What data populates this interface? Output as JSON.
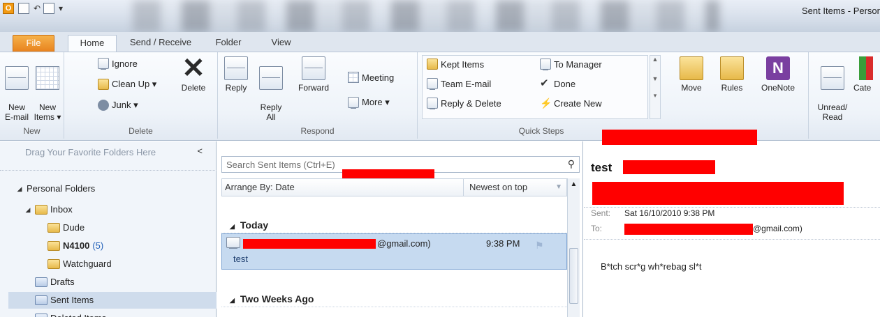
{
  "window": {
    "title": "Sent Items - Persor"
  },
  "tabs": {
    "file": "File",
    "home": "Home",
    "send_receive": "Send / Receive",
    "folder": "Folder",
    "view": "View"
  },
  "ribbon": {
    "new_group": {
      "label": "New",
      "new_email": "New\nE-mail",
      "new_items": "New\nItems ▾"
    },
    "delete_group": {
      "label": "Delete",
      "ignore": "Ignore",
      "clean_up": "Clean Up ▾",
      "junk": "Junk ▾",
      "delete": "Delete"
    },
    "respond_group": {
      "label": "Respond",
      "reply": "Reply",
      "reply_all": "Reply\nAll",
      "forward": "Forward",
      "meeting": "Meeting",
      "more": "More ▾"
    },
    "quick_steps": {
      "label": "Quick Steps",
      "kept_items": "Kept Items",
      "team_email": "Team E-mail",
      "reply_delete": "Reply & Delete",
      "to_manager": "To Manager",
      "done": "Done",
      "create_new": "Create New"
    },
    "move_group": {
      "move": "Move",
      "rules": "Rules",
      "onenote": "OneNote"
    },
    "tags_group": {
      "unread_read": "Unread/\nRead",
      "categorize": "Cate"
    }
  },
  "nav": {
    "drag_favorites": "Drag Your Favorite Folders Here",
    "personal_folders": "Personal Folders",
    "inbox": "Inbox",
    "dude": "Dude",
    "n4100": "N4100",
    "n4100_count": "(5)",
    "watchguard": "Watchguard",
    "drafts": "Drafts",
    "sent_items": "Sent Items",
    "deleted_items": "Deleted Items"
  },
  "list": {
    "search_placeholder": "Search Sent Items (Ctrl+E)",
    "arrange_by": "Arrange By: Date",
    "sort_order": "Newest on top",
    "group_today": "Today",
    "group_two_weeks": "Two Weeks Ago",
    "item": {
      "from_suffix": "@gmail.com)",
      "time": "9:38 PM",
      "subject": "test"
    }
  },
  "reading": {
    "subject": "test",
    "sent_label": "Sent:",
    "sent_value": "Sat 16/10/2010 9:38 PM",
    "to_label": "To:",
    "to_suffix": "@gmail.com)",
    "body": "B*tch scr*g wh*rebag sl*t"
  }
}
